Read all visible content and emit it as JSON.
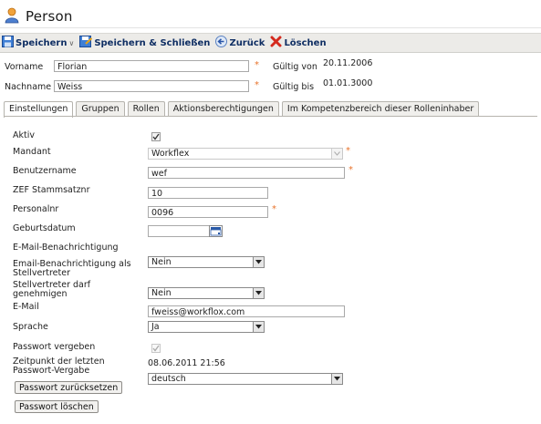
{
  "header": {
    "title": "Person"
  },
  "toolbar": {
    "save": "Speichern",
    "save_close": "Speichern & Schließen",
    "back": "Zurück",
    "delete": "Löschen"
  },
  "person": {
    "firstname_label": "Vorname",
    "firstname_value": "Florian",
    "lastname_label": "Nachname",
    "lastname_value": "Weiss",
    "valid_from_label": "Gültig von",
    "valid_from_value": "20.11.2006",
    "valid_to_label": "Gültig bis",
    "valid_to_value": "01.01.3000",
    "required_marker": "*"
  },
  "tabs": [
    {
      "label": "Einstellungen",
      "active": true
    },
    {
      "label": "Gruppen",
      "active": false
    },
    {
      "label": "Rollen",
      "active": false
    },
    {
      "label": "Aktionsberechtigungen",
      "active": false
    },
    {
      "label": "Im Kompetenzbereich dieser Rolleninhaber",
      "active": false
    }
  ],
  "form": {
    "aktiv_label": "Aktiv",
    "aktiv_checked": true,
    "mandant_label": "Mandant",
    "mandant_value": "Workflex",
    "username_label": "Benutzername",
    "username_value": "wef",
    "zef_label": "ZEF Stammsatznr",
    "zef_value": "10",
    "personalnr_label": "Personalnr",
    "personalnr_value": "0096",
    "birthdate_label": "Geburtsdatum",
    "birthdate_value": "",
    "email_notify_label": "E-Mail-Benachrichtigung",
    "email_notify_value": "Nein",
    "email_notify_deputy_label_1": "Email-Benachrichtigung als",
    "email_notify_deputy_label_2": "Stellvertreter",
    "email_notify_deputy_value": "Nein",
    "deputy_approve_label_1": "Stellvertreter darf",
    "deputy_approve_label_2": "genehmigen",
    "deputy_approve_value": "Ja",
    "email_label": "E-Mail",
    "email_value": "fweiss@workflox.com",
    "language_label": "Sprache",
    "language_value": "deutsch",
    "password_set_label": "Passwort vergeben",
    "password_set_checked": true,
    "last_pw_label_1": "Zeitpunkt der letzten",
    "last_pw_label_2": "Passwort-Vergabe",
    "last_pw_value": "08.06.2011 21:56",
    "reset_pw_button": "Passwort zurücksetzen",
    "delete_pw_button": "Passwort löschen"
  },
  "colors": {
    "required": "#e8732b",
    "toolbar_text": "#0f2e63",
    "delete_icon": "#d42a1e"
  }
}
